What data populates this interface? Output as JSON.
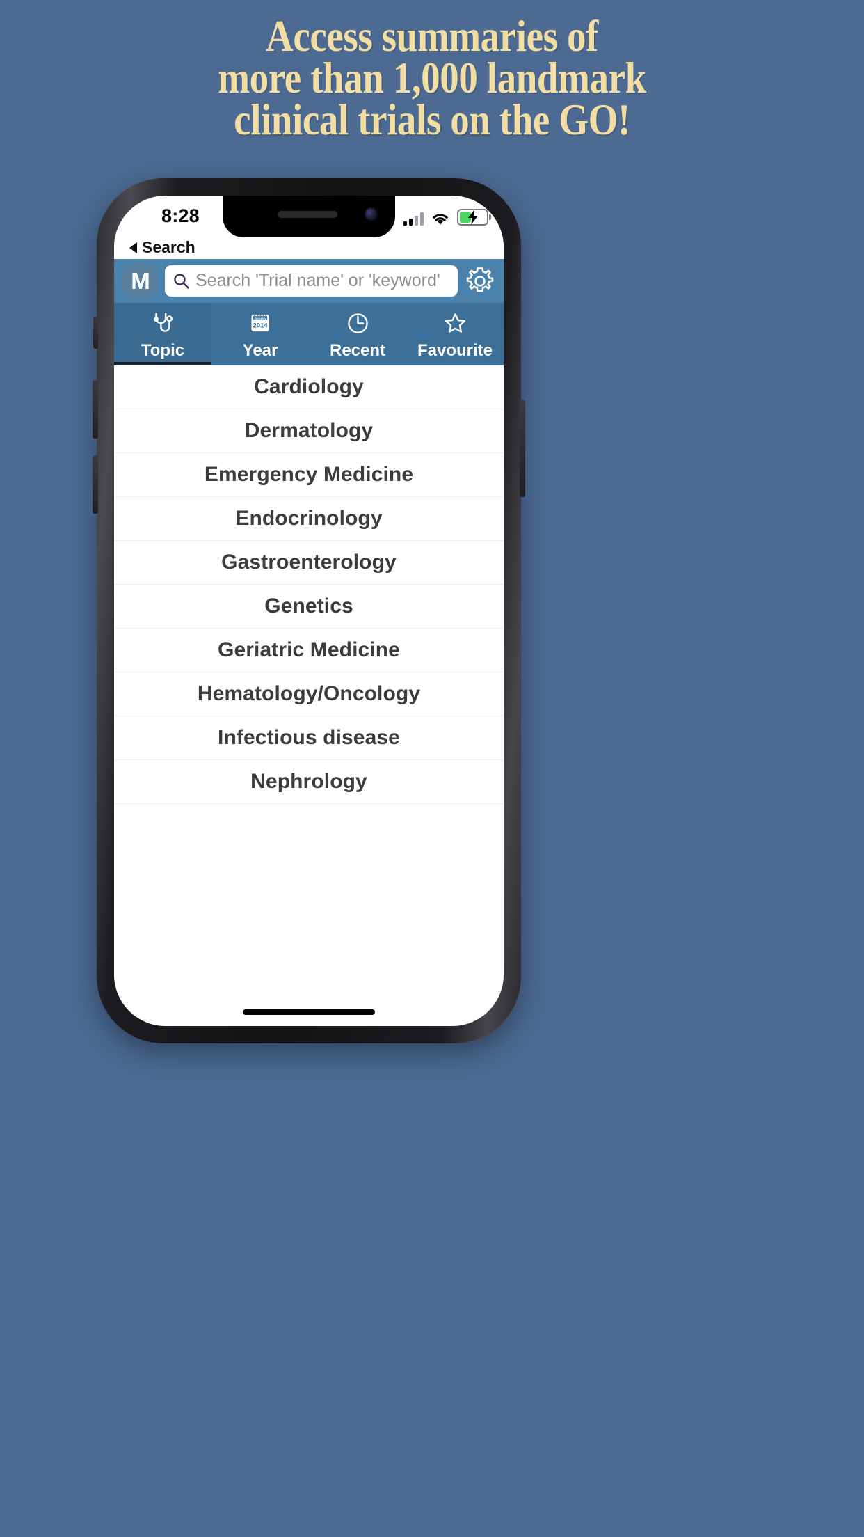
{
  "promo": {
    "headline_lines": [
      "Access summaries of",
      "more than 1,000 landmark",
      "clinical trials on the GO!"
    ],
    "background_color": "#4c6a92",
    "headline_color": "#f2dda3"
  },
  "device": {
    "status_bar": {
      "time": "8:28",
      "back_label": "Search",
      "signal_icon": "cellular-signal-icon",
      "wifi_icon": "wifi-icon",
      "battery_icon": "battery-charging-icon",
      "battery_charging": true
    },
    "home_indicator": "home-indicator"
  },
  "app": {
    "accent_color": "#4a82ab",
    "tabbar_color": "#3d7098",
    "header": {
      "logo_letter": "M",
      "logo_name": "app-logo",
      "search": {
        "placeholder": "Search 'Trial name' or 'keyword'",
        "value": "",
        "icon": "search-icon"
      },
      "settings_icon": "gear-icon"
    },
    "tabs": [
      {
        "label": "Topic",
        "icon": "stethoscope-icon",
        "active": true
      },
      {
        "label": "Year",
        "icon": "calendar-icon",
        "active": false
      },
      {
        "label": "Recent",
        "icon": "clock-icon",
        "active": false
      },
      {
        "label": "Favourite",
        "icon": "star-icon",
        "active": false
      }
    ],
    "calendar_icon_text": {
      "month": "January",
      "year": "2014"
    },
    "topics": [
      "Cardiology",
      "Dermatology",
      "Emergency Medicine",
      "Endocrinology",
      "Gastroenterology",
      "Genetics",
      "Geriatric Medicine",
      "Hematology/Oncology",
      "Infectious disease",
      "Nephrology"
    ]
  }
}
